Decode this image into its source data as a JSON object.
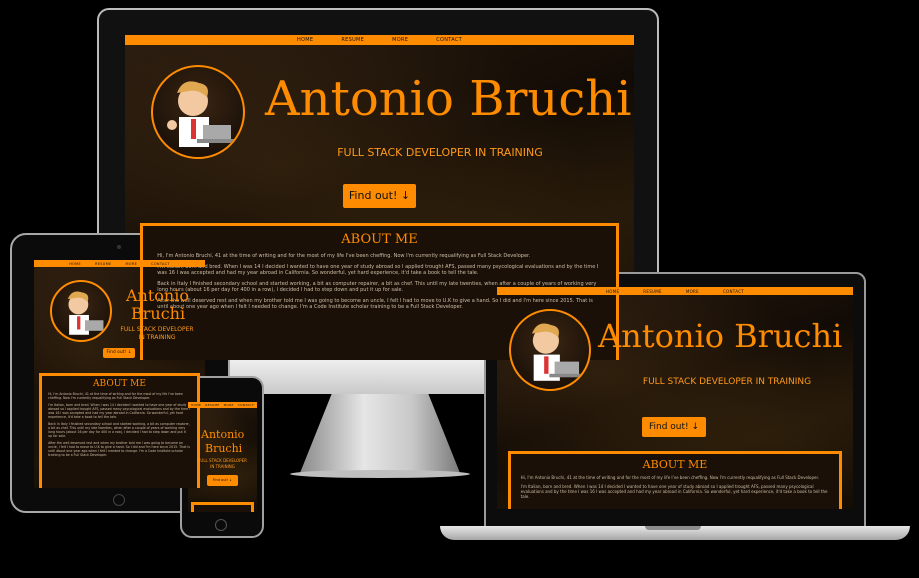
{
  "site": {
    "nav": [
      "HOME",
      "RESUME",
      "MORE",
      "CONTACT"
    ],
    "name": "Antonio Bruchi",
    "name_line1": "Antonio",
    "name_line2": "Bruchi",
    "subtitle": "FULL STACK DEVELOPER IN TRAINING",
    "subtitle_line1": "FULL STACK DEVELOPER",
    "subtitle_line2": "IN TRAINING",
    "cta": "Find out! ↓",
    "about_title": "ABOUT ME",
    "about_paragraphs": [
      "Hi, I'm Antonio Bruchi, 41 at the time of writing and for the most of my life I've been cheffing. Now I'm currently requalifying as Full Stack Developer.",
      "I'm Italian, born and bred. When I was 14 I decided I wanted to have one year of study abroad so I applied trought AFS, passed many psycological evaluations and by the time I was 16 I was accepted and had my year abroad in California. So wonderful, yet hard experience, it'd take a book to tell the tale.",
      "Back in Italy I finished secondary school and started working, a bit as computer repairer, a bit as chef. This until my late twenties, when after a couple of years of working very long hours (about 16 per day for 400 in a row), I decided I had to step down and put it up for sale.",
      "After the well deserved rest and when my brother told me I was going to become an uncle, I felt I had to move to U.K to give a hand. So I did and I'm here since 2015. That is until about one year ago when I felt I needed to change. I'm a Code Institute scholar training to be a Full Stack Developer."
    ]
  },
  "colors": {
    "accent": "#ff8c00",
    "background": "#000000"
  },
  "icons": [
    "arrow-down-icon",
    "developer-avatar-icon"
  ]
}
